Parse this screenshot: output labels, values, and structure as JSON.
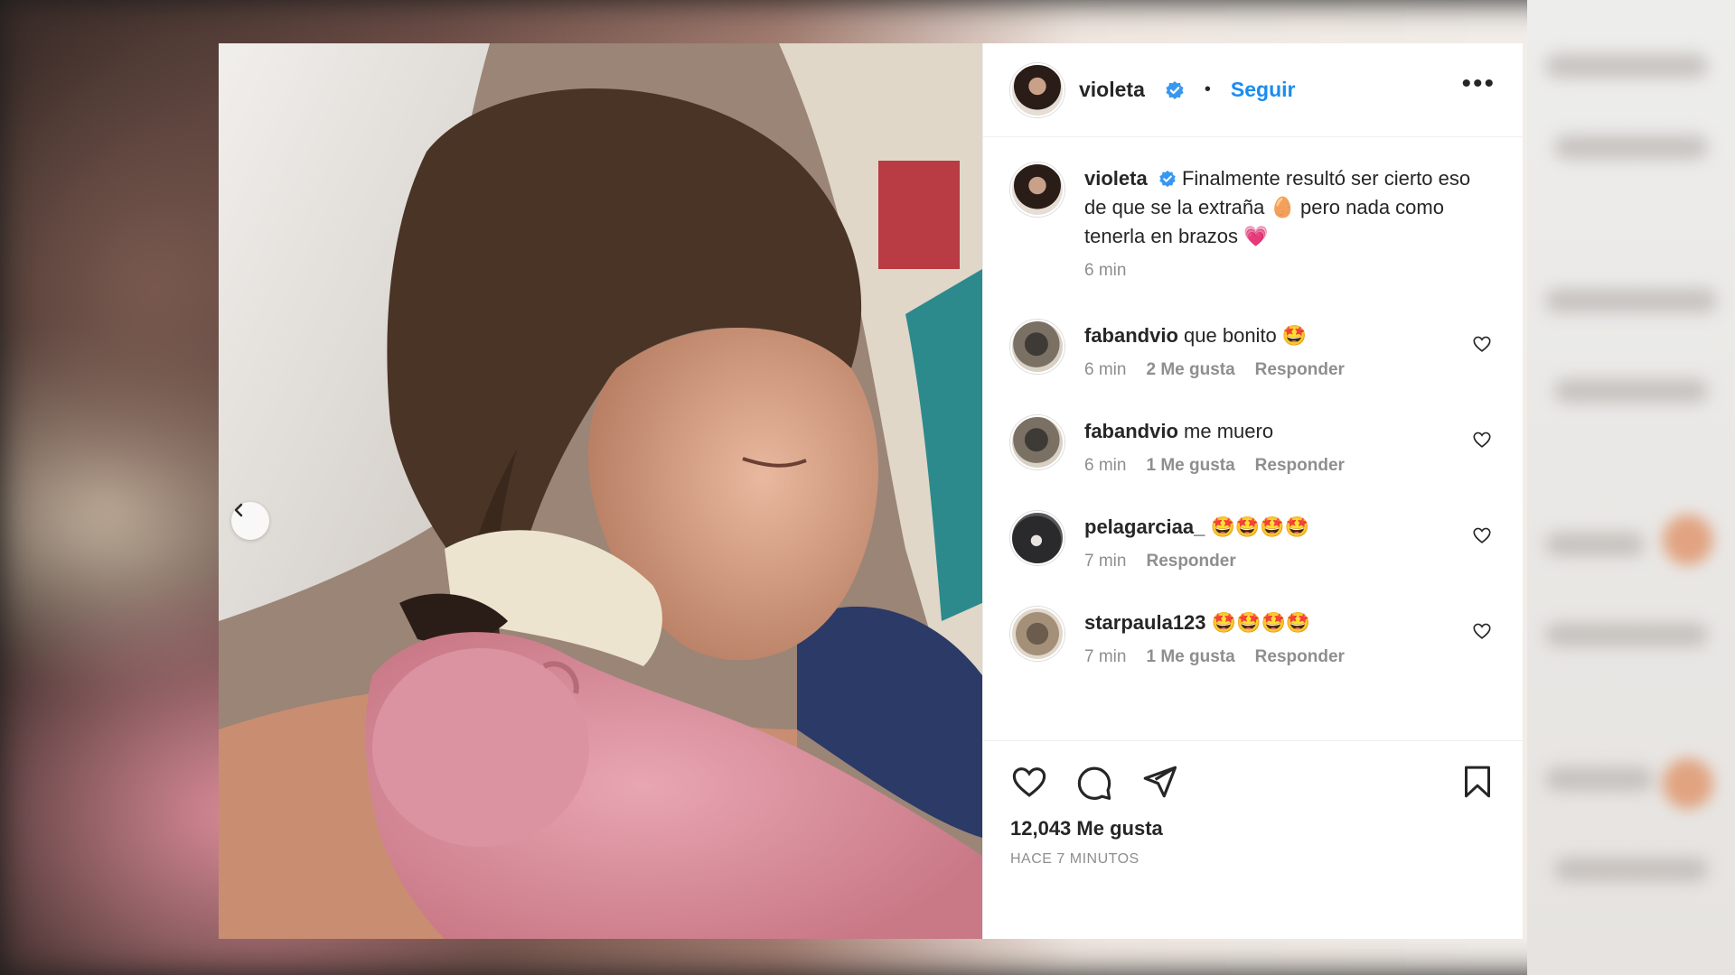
{
  "post": {
    "author": "violeta",
    "follow_label": "Seguir",
    "more_label": "•••",
    "caption": {
      "author": "violeta",
      "text": "Finalmente resultó ser cierto eso de que se la extraña 🥚 pero nada como tenerla en brazos 💗",
      "time": "6 min"
    },
    "comments": [
      {
        "user": "fabandvio",
        "text": "que bonito 🤩",
        "time": "6 min",
        "likes": "2 Me gusta",
        "reply": "Responder"
      },
      {
        "user": "fabandvio",
        "text": "me muero",
        "time": "6 min",
        "likes": "1 Me gusta",
        "reply": "Responder"
      },
      {
        "user": "pelagarciaa_",
        "text": "🤩🤩🤩🤩",
        "time": "7 min",
        "likes": null,
        "reply": "Responder"
      },
      {
        "user": "starpaula123",
        "text": "🤩🤩🤩🤩",
        "time": "7 min",
        "likes": "1 Me gusta",
        "reply": "Responder"
      }
    ],
    "likes_count": "12,043 Me gusta",
    "posted_ago": "HACE 7 MINUTOS"
  },
  "colors": {
    "accent": "#1a8cf0",
    "verified": "#3897f0",
    "text": "#262626",
    "muted": "#8e8e8e"
  },
  "icons": [
    "chevron-left-icon",
    "verified-badge-icon",
    "more-icon",
    "heart-icon",
    "comment-icon",
    "share-icon",
    "bookmark-icon"
  ]
}
